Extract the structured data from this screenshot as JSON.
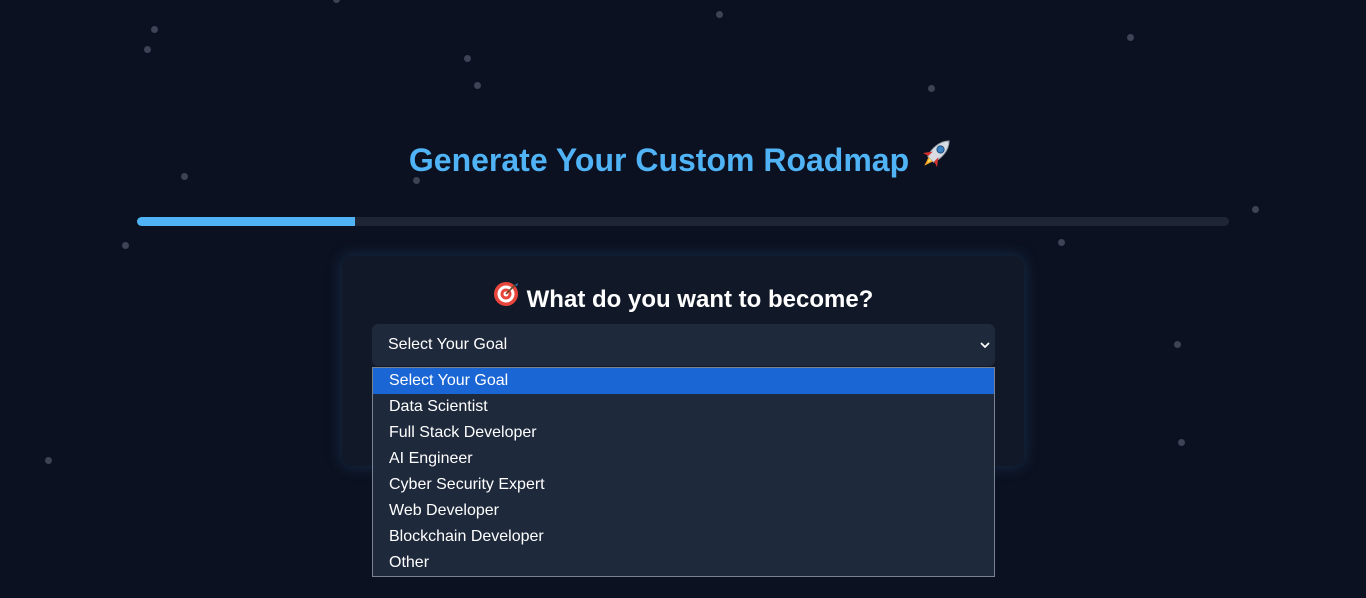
{
  "header": {
    "title": "Generate Your Custom Roadmap",
    "title_icon": "rocket-icon"
  },
  "progress": {
    "fraction": 0.2,
    "color": "#4fb3f6",
    "track_color": "#1e2635"
  },
  "card": {
    "question": "What do you want to become?",
    "question_icon": "target-icon",
    "select": {
      "value": "Select Your Goal",
      "options": [
        "Select Your Goal",
        "Data Scientist",
        "Full Stack Developer",
        "AI Engineer",
        "Cyber Security Expert",
        "Web Developer",
        "Blockchain Developer",
        "Other"
      ],
      "highlighted_index": 0,
      "highlight_color": "#1a66d4"
    }
  },
  "colors": {
    "background": "#0b1120",
    "accent": "#4fb3f6",
    "card": "#111827",
    "input": "#1e293b"
  }
}
